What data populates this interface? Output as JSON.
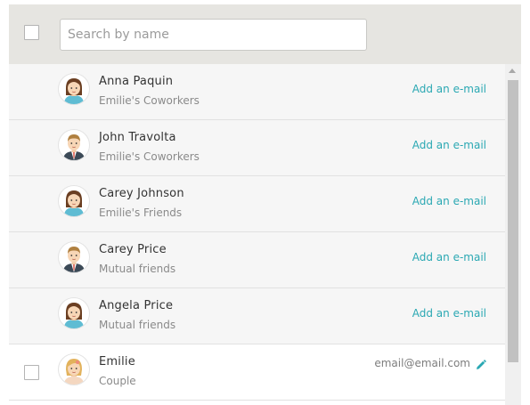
{
  "search": {
    "placeholder": "Search by name",
    "value": ""
  },
  "contacts": [
    {
      "name": "Anna Paquin",
      "group": "Emilie's Coworkers",
      "action": "Add an e-mail",
      "avatar": "female-avatar-icon"
    },
    {
      "name": "John Travolta",
      "group": "Emilie's Coworkers",
      "action": "Add an e-mail",
      "avatar": "male-avatar-icon"
    },
    {
      "name": "Carey Johnson",
      "group": "Emilie's Friends",
      "action": "Add an e-mail",
      "avatar": "female-avatar-icon"
    },
    {
      "name": "Carey Price",
      "group": "Mutual friends",
      "action": "Add an e-mail",
      "avatar": "male-avatar-icon"
    },
    {
      "name": "Angela Price",
      "group": "Mutual friends",
      "action": "Add an e-mail",
      "avatar": "female-avatar-icon"
    },
    {
      "name": "Emilie",
      "group": "Couple",
      "email": "email@email.com",
      "avatar": "blonde-female-avatar-icon",
      "edit_icon": "pencil-icon"
    }
  ],
  "colors": {
    "header_bg": "#e6e5e1",
    "row_bg": "#f6f6f6",
    "link": "#2aa8b3",
    "text": "#333333",
    "muted": "#8a8a8a"
  }
}
